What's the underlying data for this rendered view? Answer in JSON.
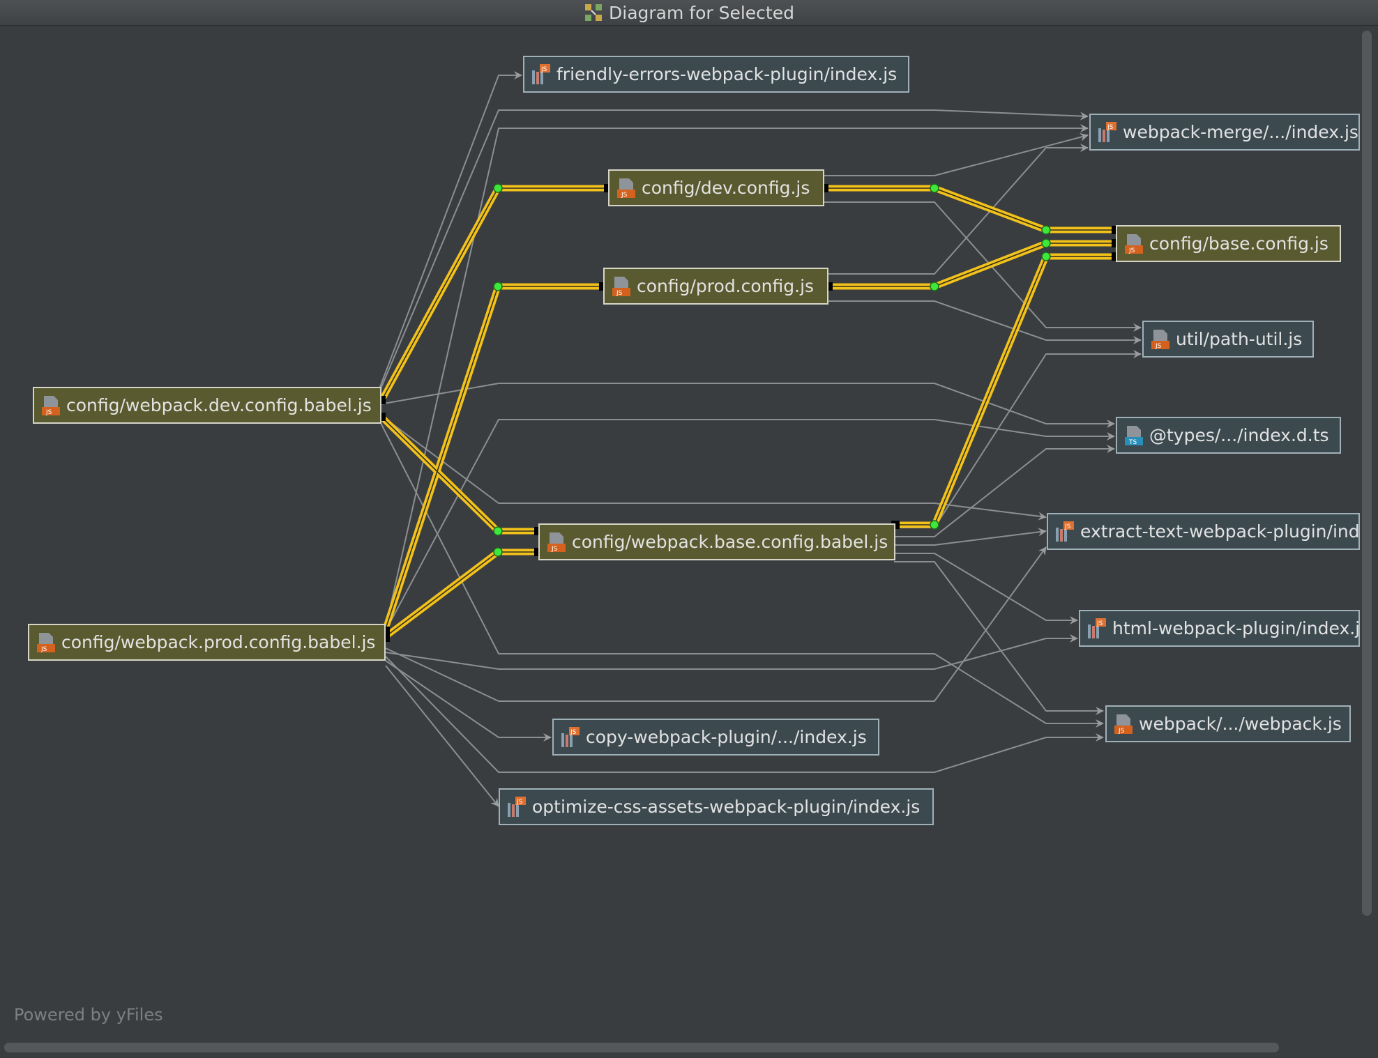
{
  "window": {
    "title": "Diagram for Selected"
  },
  "footer": {
    "powered_by": "Powered by yFiles"
  },
  "colors": {
    "background": "#3a3d40",
    "highlight_edge": "#f2c21b",
    "edge": "#8c8f92",
    "selected_node": "#5a5a30",
    "external_node": "#3c4a50",
    "edge_point": "#3ee83a"
  },
  "nodes": {
    "friendly_errors": {
      "label": "friendly-errors-webpack-plugin/index.js",
      "icon": "js-library-icon"
    },
    "webpack_merge": {
      "label": "webpack-merge/.../index.js",
      "icon": "js-library-icon"
    },
    "dev_config": {
      "label": "config/dev.config.js",
      "icon": "js-file-icon"
    },
    "base_config": {
      "label": "config/base.config.js",
      "icon": "js-file-icon"
    },
    "prod_config": {
      "label": "config/prod.config.js",
      "icon": "js-file-icon"
    },
    "path_util": {
      "label": "util/path-util.js",
      "icon": "js-file-icon"
    },
    "webpack_dev_babel": {
      "label": "config/webpack.dev.config.babel.js",
      "icon": "js-file-icon"
    },
    "types_index": {
      "label": "@types/.../index.d.ts",
      "icon": "ts-file-icon"
    },
    "webpack_base_babel": {
      "label": "config/webpack.base.config.babel.js",
      "icon": "js-file-icon"
    },
    "extract_text": {
      "label": "extract-text-webpack-plugin/ind",
      "icon": "js-library-icon"
    },
    "html_webpack": {
      "label": "html-webpack-plugin/index.j",
      "icon": "js-library-icon"
    },
    "webpack_prod_babel": {
      "label": "config/webpack.prod.config.babel.js",
      "icon": "js-file-icon"
    },
    "webpack_js": {
      "label": "webpack/.../webpack.js",
      "icon": "js-file-icon"
    },
    "copy_webpack": {
      "label": "copy-webpack-plugin/.../index.js",
      "icon": "js-library-icon"
    },
    "optimize_css": {
      "label": "optimize-css-assets-webpack-plugin/index.js",
      "icon": "js-library-icon"
    }
  }
}
